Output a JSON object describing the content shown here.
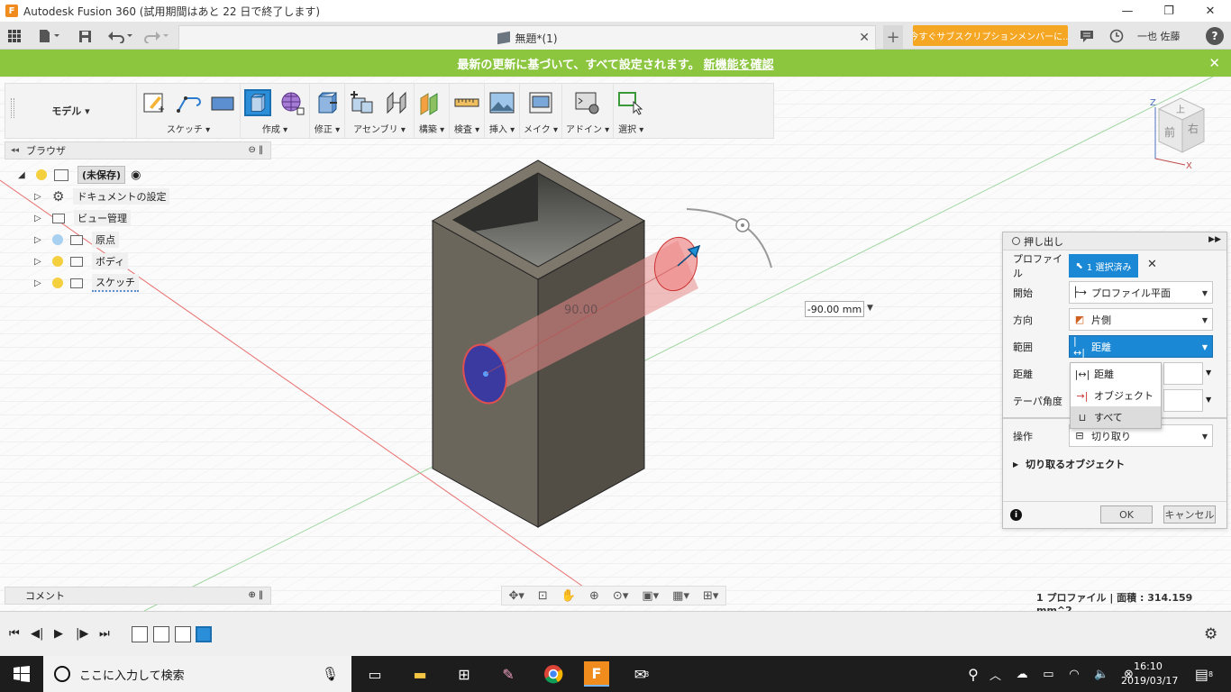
{
  "window": {
    "title": "Autodesk Fusion 360 (試用期間はあと 22 日で終了します)",
    "app_icon": "F",
    "minimize": "—",
    "restore": "❐",
    "close": "✕"
  },
  "appbar": {
    "doc_tab_title": "無題*(1)",
    "subscribe_label": "今すぐサブスクリプションメンバーに...",
    "user_name": "一也 佐藤",
    "help": "?"
  },
  "banner": {
    "text": "最新の更新に基づいて、すべて設定されます。",
    "link": "新機能を確認",
    "close": "✕"
  },
  "toolbar": {
    "workspace": "モデル ▾",
    "groups": [
      "スケッチ ▾",
      "作成 ▾",
      "修正 ▾",
      "アセンブリ ▾",
      "構築 ▾",
      "検査 ▾",
      "挿入 ▾",
      "メイク ▾",
      "アドイン ▾",
      "選択 ▾"
    ]
  },
  "browser": {
    "title": "ブラウザ",
    "collapse": "◂◂",
    "root": "(未保存)",
    "items": [
      "ドキュメントの設定",
      "ビュー管理",
      "原点",
      "ボディ",
      "スケッチ"
    ]
  },
  "comments": {
    "title": "コメント"
  },
  "viewport": {
    "dimension_label": "90.00",
    "distance_value": "-90.00 mm",
    "status": "1 プロファイル | 面積 : 314.159 mm^2",
    "viewcube_front": "前",
    "viewcube_right": "右",
    "viewcube_top": "上",
    "axis_z": "Z",
    "axis_x": "X"
  },
  "extrude_dialog": {
    "title": "押し出し",
    "rows": {
      "profile_label": "プロファイル",
      "profile_value": "1 選択済み",
      "start_label": "開始",
      "start_value": "プロファイル平面",
      "direction_label": "方向",
      "direction_value": "片側",
      "extent_label": "範囲",
      "extent_value": "距離",
      "distance_label": "距離",
      "taper_label": "テーパ角度",
      "operation_label": "操作",
      "operation_value": "切り取り"
    },
    "dropdown": [
      "距離",
      "オブジェクト",
      "すべて"
    ],
    "section": "切り取るオブジェクト",
    "ok": "OK",
    "cancel": "キャンセル"
  },
  "taskbar": {
    "search_placeholder": "ここに入力して検索",
    "time": "16:10",
    "date": "2019/03/17",
    "notification_count": "8",
    "mail_badge": "8"
  }
}
